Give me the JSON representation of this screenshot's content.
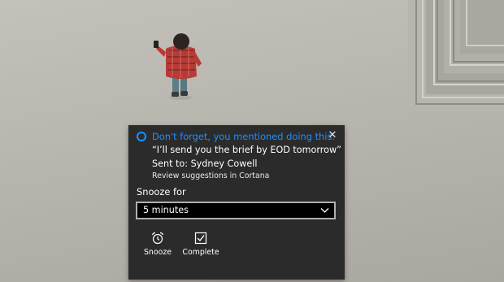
{
  "toast": {
    "title": "Don't forget, you mentioned doing this.",
    "quote": "“I’ll send you the brief by EOD tomorrow”",
    "sent_to": "Sent to: Sydney Cowell",
    "review": "Review suggestions in Cortana",
    "close_icon": "close-icon",
    "app_icon": "cortana-circle-icon",
    "accent_color": "#1e90ff",
    "background_color": "#2b2b2b"
  },
  "snooze": {
    "label": "Snooze for",
    "selected": "5 minutes"
  },
  "actions": {
    "snooze_label": "Snooze",
    "snooze_icon": "alarm-clock-icon",
    "complete_label": "Complete",
    "complete_icon": "checkbox-icon"
  }
}
